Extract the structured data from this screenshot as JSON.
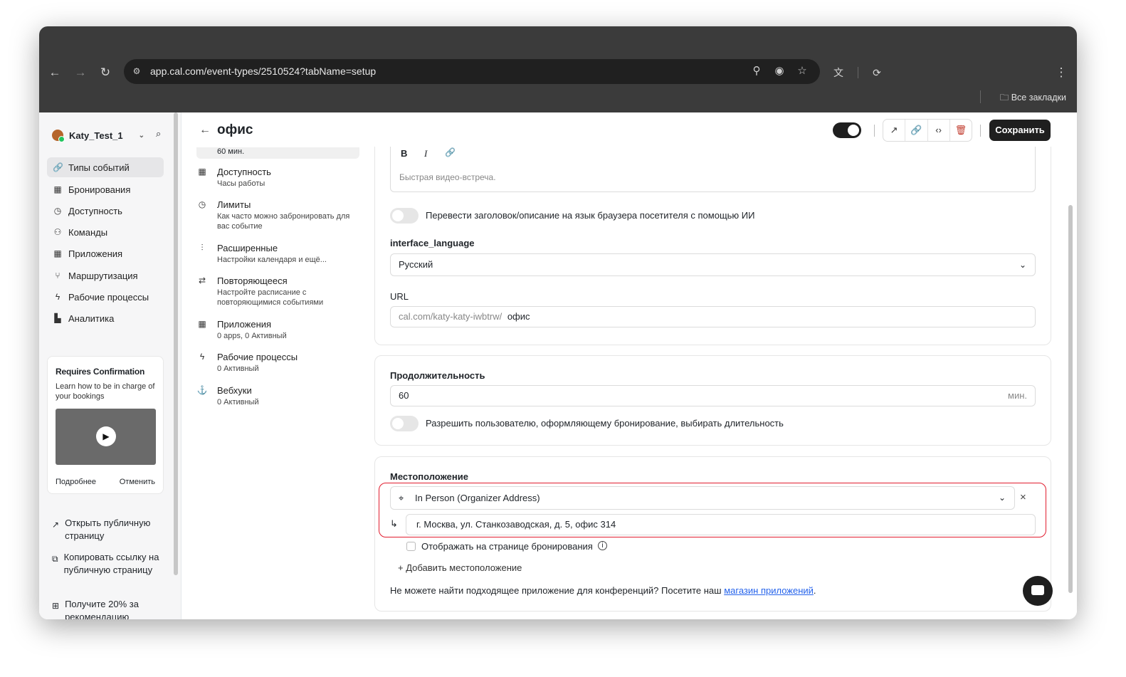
{
  "browser": {
    "url": "app.cal.com/event-types/2510524?tabName=setup",
    "bookmarks": "Все закладки"
  },
  "sidebar": {
    "user": "Katy_Test_1",
    "items": [
      {
        "label": "Типы событий",
        "icon": "link-icon",
        "active": true
      },
      {
        "label": "Бронирования",
        "icon": "calendar-icon"
      },
      {
        "label": "Доступность",
        "icon": "clock-icon"
      },
      {
        "label": "Команды",
        "icon": "users-icon"
      },
      {
        "label": "Приложения",
        "icon": "grid-icon"
      },
      {
        "label": "Маршрутизация",
        "icon": "route-icon"
      },
      {
        "label": "Рабочие процессы",
        "icon": "zap-icon"
      },
      {
        "label": "Аналитика",
        "icon": "chart-icon"
      }
    ],
    "promo": {
      "title": "Requires Confirmation",
      "text": "Learn how to be in charge of your bookings",
      "learn_more": "Подробнее",
      "dismiss": "Отменить"
    },
    "bottom": {
      "public_page": "Открыть публичную страницу",
      "copy_link": "Копировать ссылку на публичную страницу",
      "referral": "Получите 20% за рекомендацию"
    }
  },
  "header": {
    "title": "офис",
    "save": "Сохранить"
  },
  "subnav": {
    "prev_sub": "60 мин.",
    "items": [
      {
        "title": "Доступность",
        "sub": "Часы работы"
      },
      {
        "title": "Лимиты",
        "sub": "Как часто можно забронировать для вас событие"
      },
      {
        "title": "Расширенные",
        "sub": "Настройки календаря и ещё..."
      },
      {
        "title": "Повторяющееся",
        "sub": "Настройте расписание с повторяющимися событиями"
      },
      {
        "title": "Приложения",
        "sub": "0 apps, 0 Активный"
      },
      {
        "title": "Рабочие процессы",
        "sub": "0 Активный"
      },
      {
        "title": "Вебхуки",
        "sub": "0 Активный"
      }
    ]
  },
  "setup": {
    "description_placeholder": "Быстрая видео-встреча.",
    "translate_label": "Перевести заголовок/описание на язык браузера посетителя с помощью ИИ",
    "language_label": "interface_language",
    "language_value": "Русский",
    "url_label": "URL",
    "url_prefix": "cal.com/katy-katy-iwbtrw/",
    "url_slug": "офис",
    "duration_label": "Продолжительность",
    "duration_value": "60",
    "duration_unit": "мин.",
    "duration_toggle_label": "Разрешить пользователю, оформляющему бронирование, выбирать длительность",
    "location_label": "Местоположение",
    "location_type": "In Person (Organizer Address)",
    "location_address": "г. Москва, ул. Станкозаводская, д. 5, офис 314",
    "show_on_booking": "Отображать на странице бронирования",
    "add_location": "Добавить местоположение",
    "footer_text": "Не можете найти подходящее приложение для конференций? Посетите наш",
    "footer_link": "магазин приложений",
    "footer_end": "."
  }
}
